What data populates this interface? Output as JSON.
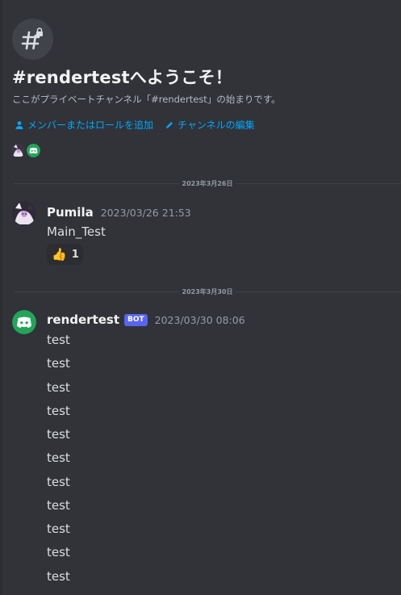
{
  "welcome": {
    "title": "#rendertestへようこそ！",
    "description": "ここがプライベートチャンネル「#rendertest」の始まりです。",
    "channel_icon": "locked-hashtag-icon"
  },
  "actions": [
    {
      "label": "メンバーまたはロールを追加",
      "icon": "person-icon"
    },
    {
      "label": "チャンネルの編集",
      "icon": "pencil-icon"
    }
  ],
  "dividers": [
    {
      "label": "2023年3月26日"
    },
    {
      "label": "2023年3月30日"
    }
  ],
  "messages": [
    {
      "author": "Pumila",
      "timestamp": "2023/03/26 21:53",
      "text": "Main_Test",
      "reaction": {
        "emoji": "👍",
        "count": "1"
      }
    },
    {
      "author": "rendertest",
      "bot_tag": "BOT",
      "timestamp": "2023/03/30 08:06",
      "lines": [
        "test",
        "test",
        "test",
        "test",
        "test",
        "test",
        "test",
        "test",
        "test",
        "test",
        "test"
      ]
    }
  ],
  "colors": {
    "background": "#313338",
    "link": "#00a8fc",
    "bot_tag": "#5865f2",
    "bot_avatar": "#23a559"
  }
}
